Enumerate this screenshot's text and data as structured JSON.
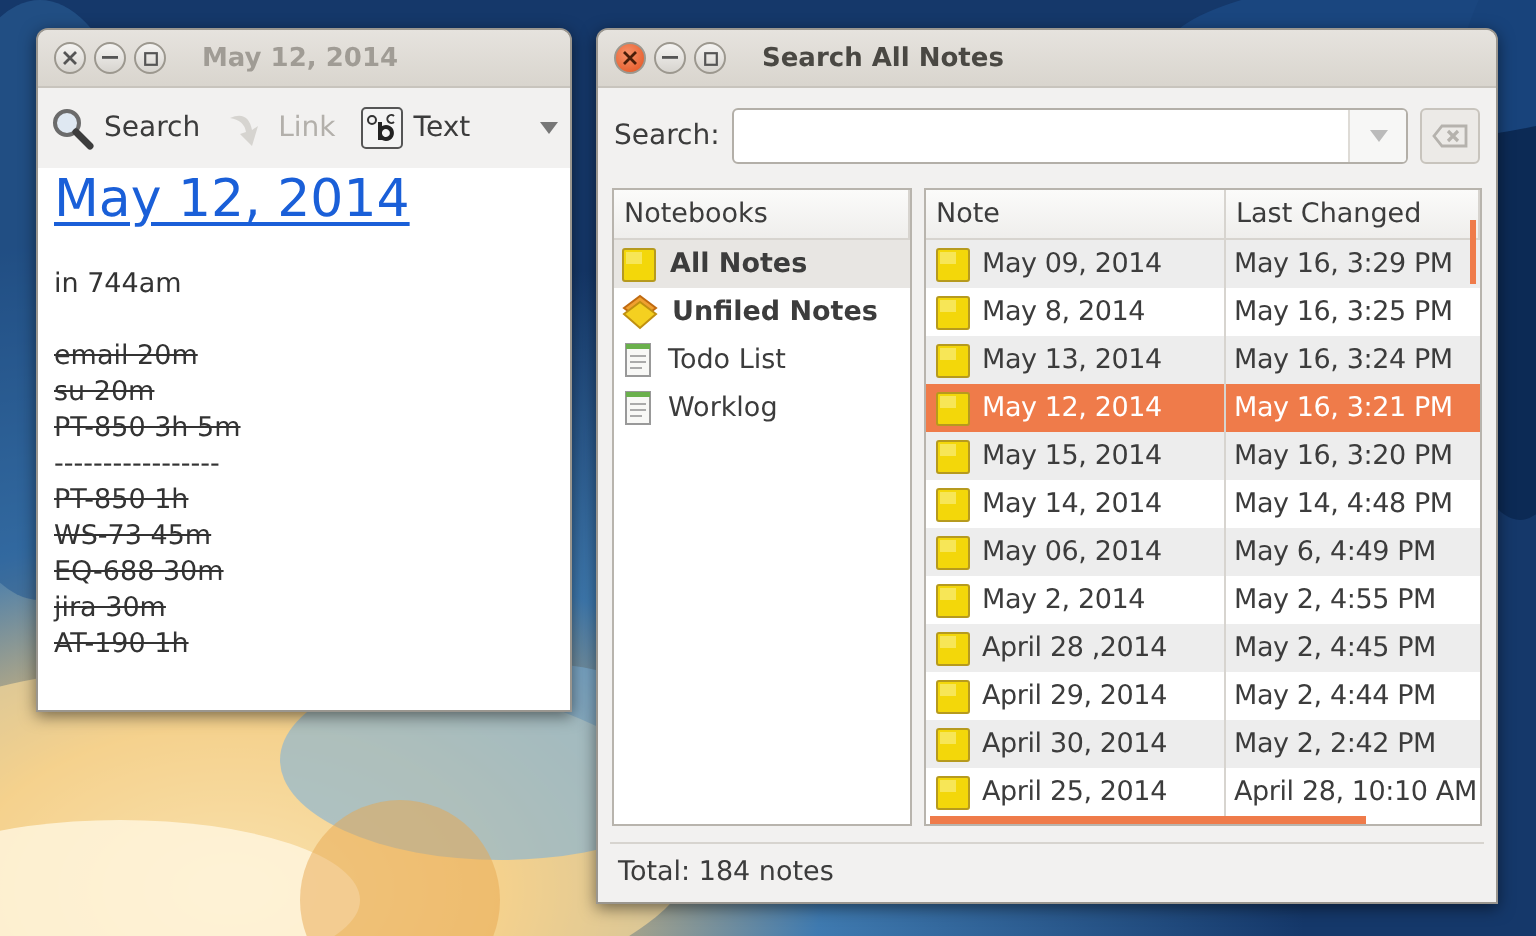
{
  "note_window": {
    "title": "May 12, 2014",
    "active": false,
    "toolbar": [
      {
        "kind": "search",
        "label": "Search",
        "disabled": false
      },
      {
        "kind": "link",
        "label": "Link",
        "disabled": true
      },
      {
        "kind": "text",
        "label": "Text",
        "disabled": false
      }
    ],
    "heading": "May 12, 2014",
    "lines": [
      {
        "text": "in 744am",
        "struck": false,
        "space_before": false
      },
      {
        "text": "email 20m",
        "struck": true,
        "space_before": true
      },
      {
        "text": "su 20m",
        "struck": true,
        "space_before": false
      },
      {
        "text": "PT-850 3h 5m",
        "struck": true,
        "space_before": false
      },
      {
        "text": "-----------------",
        "struck": false,
        "space_before": false
      },
      {
        "text": "PT-850 1h",
        "struck": true,
        "space_before": false
      },
      {
        "text": "WS-73 45m",
        "struck": true,
        "space_before": false
      },
      {
        "text": "EQ-688 30m",
        "struck": true,
        "space_before": false
      },
      {
        "text": "jira 30m",
        "struck": true,
        "space_before": false
      },
      {
        "text": "AT-190 1h",
        "struck": true,
        "space_before": false
      }
    ]
  },
  "search_window": {
    "title": "Search All Notes",
    "active": true,
    "search": {
      "label": "Search:"
    },
    "notebooks": {
      "heading": "Notebooks",
      "items": [
        {
          "label": "All Notes",
          "kind": "all",
          "selected": true
        },
        {
          "label": "Unfiled Notes",
          "kind": "unfiled",
          "selected": false
        },
        {
          "label": "Todo List",
          "kind": "notebook",
          "selected": false
        },
        {
          "label": "Worklog",
          "kind": "notebook",
          "selected": false
        }
      ]
    },
    "notes": {
      "columns": [
        "Note",
        "Last Changed"
      ],
      "rows": [
        {
          "note": "May 09, 2014",
          "changed": "May 16, 3:29 PM",
          "selected": false
        },
        {
          "note": "May 8, 2014",
          "changed": "May 16, 3:25 PM",
          "selected": false
        },
        {
          "note": "May 13, 2014",
          "changed": "May 16, 3:24 PM",
          "selected": false
        },
        {
          "note": "May 12, 2014",
          "changed": "May 16, 3:21 PM",
          "selected": true
        },
        {
          "note": "May 15, 2014",
          "changed": "May 16, 3:20 PM",
          "selected": false
        },
        {
          "note": "May 14, 2014",
          "changed": "May 14, 4:48 PM",
          "selected": false
        },
        {
          "note": "May 06, 2014",
          "changed": "May 6, 4:49 PM",
          "selected": false
        },
        {
          "note": "May 2, 2014",
          "changed": "May 2, 4:55 PM",
          "selected": false
        },
        {
          "note": "April 28 ,2014",
          "changed": "May 2, 4:45 PM",
          "selected": false
        },
        {
          "note": "April 29, 2014",
          "changed": "May 2, 4:44 PM",
          "selected": false
        },
        {
          "note": "April 30, 2014",
          "changed": "May 2, 2:42 PM",
          "selected": false
        },
        {
          "note": "April 25, 2014",
          "changed": "April 28, 10:10 AM",
          "selected": false
        }
      ]
    },
    "status": "Total: 184 notes"
  }
}
